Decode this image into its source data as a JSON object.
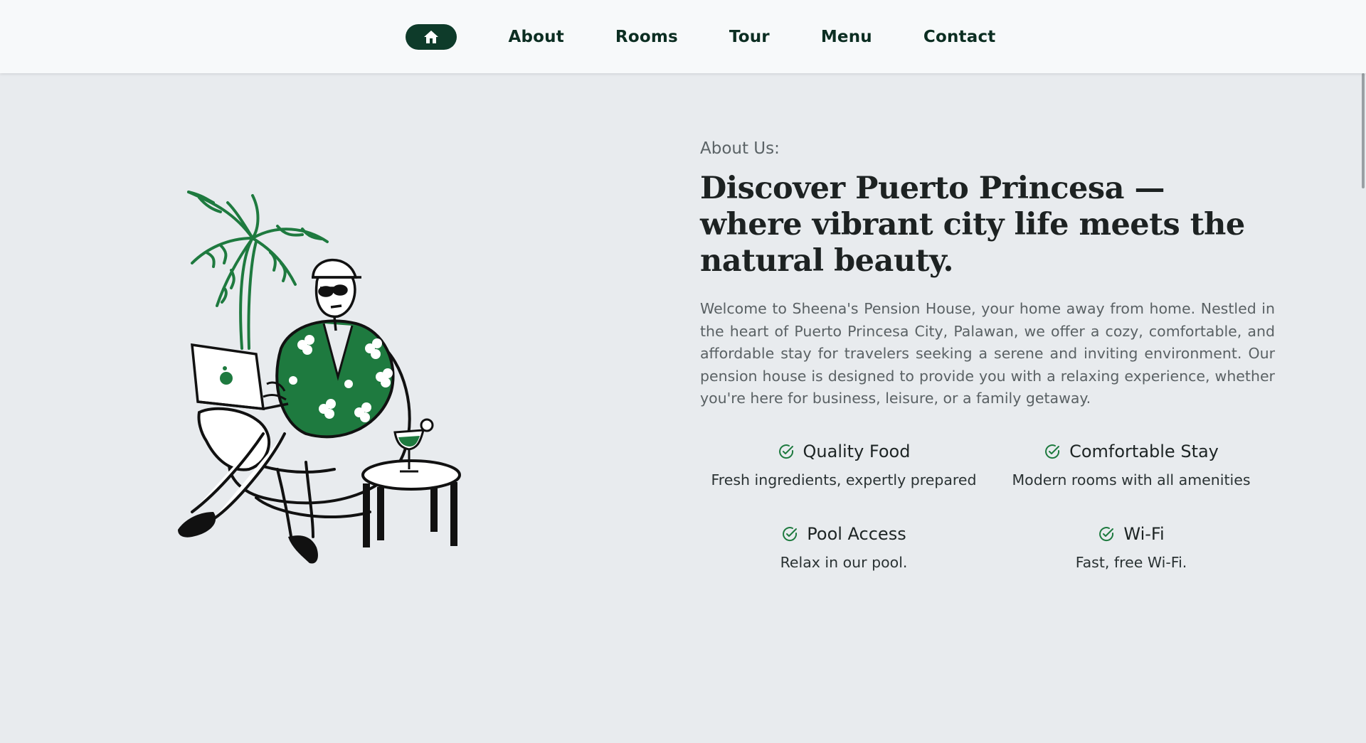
{
  "nav": {
    "home_icon": "home-icon",
    "links": [
      "About",
      "Rooms",
      "Tour",
      "Menu",
      "Contact"
    ]
  },
  "colors": {
    "brand_dark_green": "#0e3b2a",
    "accent_green": "#1e7a3f",
    "background": "#e8ebee"
  },
  "about": {
    "eyebrow": "About Us:",
    "headline": "Discover Puerto Princesa — where vibrant city life meets the natural beauty.",
    "body": "Welcome to Sheena's Pension House, your home away from home. Nestled in the heart of Puerto Princesa City, Palawan, we offer a cozy, comfortable, and affordable stay for travelers seeking a serene and inviting environment. Our pension house is designed to provide you with a relaxing experience, whether you're here for business, leisure, or a family getaway."
  },
  "features": [
    {
      "icon": "check-circle-icon",
      "title": "Quality Food",
      "desc": "Fresh ingredients, expertly prepared"
    },
    {
      "icon": "check-circle-icon",
      "title": "Comfortable Stay",
      "desc": "Modern rooms with all amenities"
    },
    {
      "icon": "check-circle-icon",
      "title": "Pool Access",
      "desc": "Relax in our pool."
    },
    {
      "icon": "check-circle-icon",
      "title": "Wi-Fi",
      "desc": "Fast, free Wi-Fi."
    }
  ]
}
